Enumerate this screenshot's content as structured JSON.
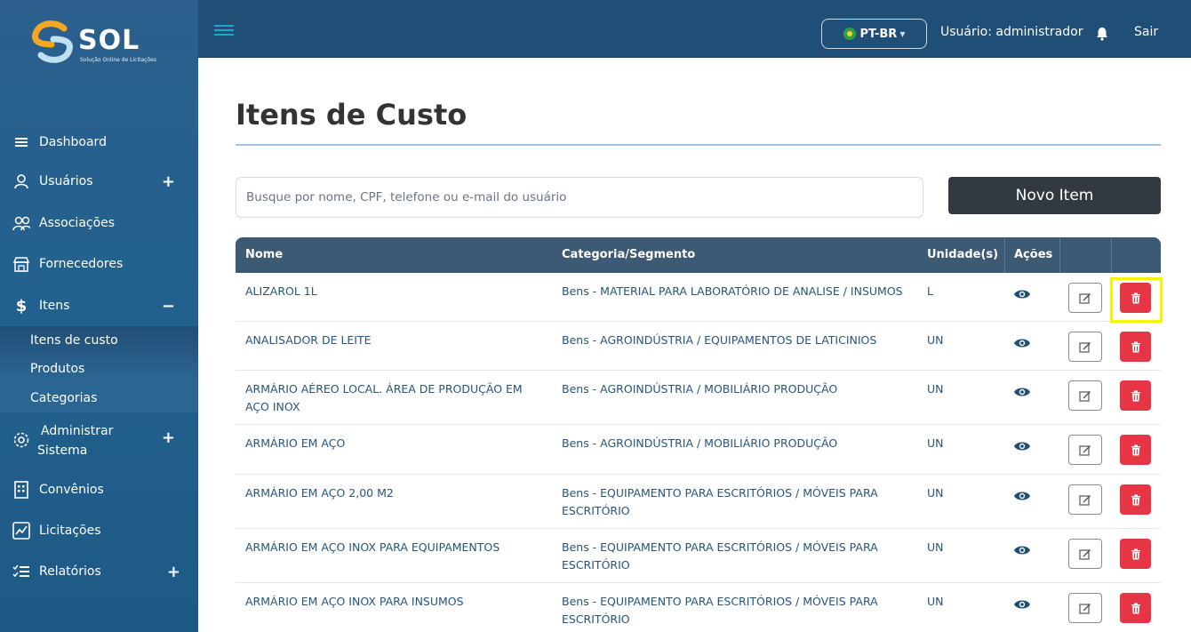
{
  "brand": {
    "name": "SOL",
    "tagline": "Solução Online de Licitações"
  },
  "sidebar": {
    "items": [
      {
        "label": "Dashboard",
        "icon": "menu-icon",
        "expander": ""
      },
      {
        "label": "Usuários",
        "icon": "user-icon",
        "expander": "+"
      },
      {
        "label": "Associações",
        "icon": "users-icon",
        "expander": ""
      },
      {
        "label": "Fornecedores",
        "icon": "store-icon",
        "expander": ""
      },
      {
        "label": "Itens",
        "icon": "dollar-icon",
        "expander": "−"
      },
      {
        "label": "Administrar",
        "label2": "Sistema",
        "icon": "gear-icon",
        "expander": "+"
      },
      {
        "label": "Convênios",
        "icon": "building-icon",
        "expander": ""
      },
      {
        "label": "Licitações",
        "icon": "chart-icon",
        "expander": ""
      },
      {
        "label": "Relatórios",
        "icon": "list-icon",
        "expander": "+"
      }
    ],
    "subitems": [
      "Itens de custo",
      "Produtos",
      "Categorias"
    ]
  },
  "topbar": {
    "language": "PT-BR",
    "user_label": "Usuário: administrador",
    "logout_label": "Sair"
  },
  "page": {
    "title": "Itens de Custo"
  },
  "search": {
    "placeholder": "Busque por nome, CPF, telefone ou e-mail do usuário"
  },
  "actions": {
    "new_item_label": "Novo Item"
  },
  "table": {
    "headers": [
      "Nome",
      "Categoria/Segmento",
      "Unidade(s)",
      "Ações"
    ],
    "rows": [
      {
        "name": "ALIZAROL 1L",
        "name2": "",
        "category": "Bens - MATERIAL PARA LABORATÓRIO DE ANALISE / INSUMOS",
        "category2": "",
        "unit": "L"
      },
      {
        "name": "ANALISADOR DE LEITE",
        "name2": "",
        "category": "Bens - AGROINDÚSTRIA / EQUIPAMENTOS DE LATICINIOS",
        "category2": "",
        "unit": "UN"
      },
      {
        "name": "ARMÁRIO AÉREO LOCAL. ÁREA DE PRODUÇÃO EM",
        "name2": "AÇO INOX",
        "category": "Bens - AGROINDÚSTRIA / MOBILIÁRIO PRODUÇÃO",
        "category2": "",
        "unit": "UN"
      },
      {
        "name": "ARMÁRIO EM AÇO",
        "name2": "",
        "category": "Bens - AGROINDÚSTRIA / MOBILIÁRIO PRODUÇÃO",
        "category2": "",
        "unit": "UN"
      },
      {
        "name": "ARMÁRIO EM AÇO 2,00 M2",
        "name2": "",
        "category": "Bens - EQUIPAMENTO PARA ESCRITÓRIOS / MÓVEIS PARA",
        "category2": "ESCRITÓRIO",
        "unit": "UN"
      },
      {
        "name": "ARMÁRIO EM AÇO INOX PARA EQUIPAMENTOS",
        "name2": "",
        "category": "Bens - EQUIPAMENTO PARA ESCRITÓRIOS / MÓVEIS PARA",
        "category2": "ESCRITÓRIO",
        "unit": "UN"
      },
      {
        "name": "ARMÁRIO EM AÇO INOX PARA INSUMOS",
        "name2": "",
        "category": "Bens - EQUIPAMENTO PARA ESCRITÓRIOS / MÓVEIS PARA",
        "category2": "ESCRITÓRIO",
        "unit": "UN"
      }
    ]
  }
}
